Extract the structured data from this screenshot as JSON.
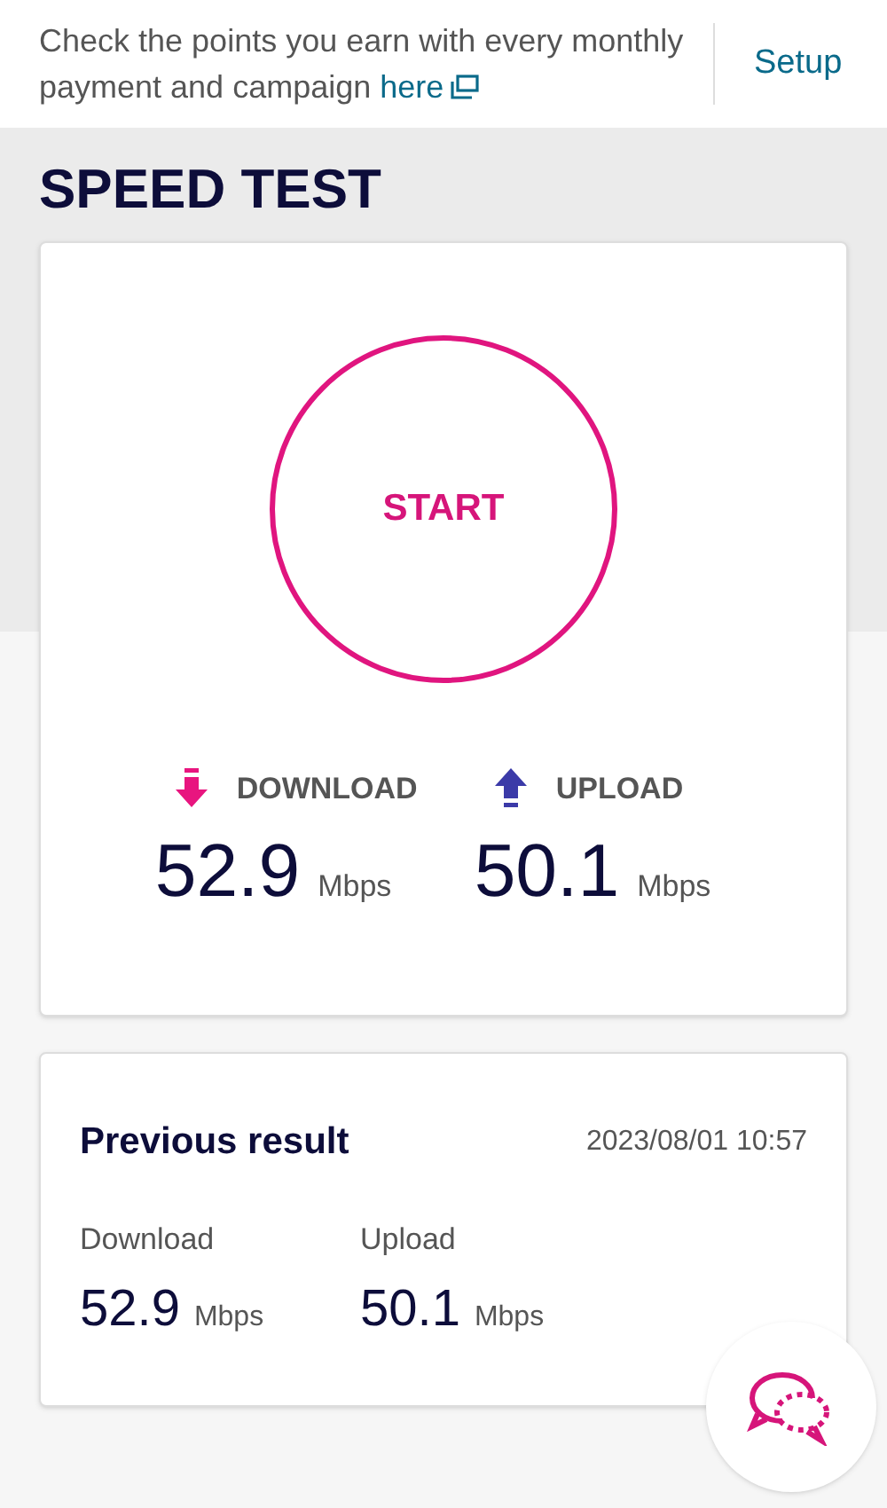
{
  "banner": {
    "text": "Check the points you earn with every monthly payment and campaign",
    "link": "here",
    "setup": "Setup"
  },
  "title": "SPEED TEST",
  "test": {
    "start": "START",
    "metrics": [
      {
        "kind": "download",
        "label": "DOWNLOAD",
        "value": "52.9",
        "unit": "Mbps"
      },
      {
        "kind": "upload",
        "label": "UPLOAD",
        "value": "50.1",
        "unit": "Mbps"
      }
    ]
  },
  "previous": {
    "title": "Previous result",
    "date": "2023/08/01 10:57",
    "metrics": [
      {
        "label": "Download",
        "value": "52.9",
        "unit": "Mbps"
      },
      {
        "label": "Upload",
        "value": "50.1",
        "unit": "Mbps"
      }
    ]
  }
}
